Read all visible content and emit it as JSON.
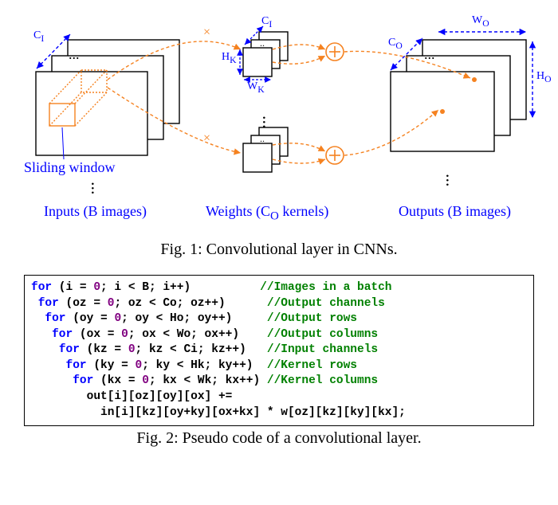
{
  "fig1": {
    "slidingWindow": "Sliding window",
    "inputs": "Inputs (B images)",
    "weights": "Weights (C",
    "weightsSubO": "O",
    "weightsRest": " kernels)",
    "outputs": "Outputs (B images)",
    "CI": "C",
    "CIsub": "I",
    "CIk": "C",
    "CIksub": "I",
    "HK": "H",
    "HKsub": "K",
    "WK": "W",
    "WKsub": "K",
    "WO": "W",
    "WOsub": "O",
    "CO": "C",
    "COsub": "O",
    "HO": "H",
    "HOsub": "O",
    "caption": "Fig. 1: Convolutional layer in CNNs."
  },
  "fig2": {
    "caption": "Fig. 2: Pseudo code of a convolutional layer.",
    "lines": {
      "l1a": "for",
      "l1b": " (i = ",
      "l1c": "0",
      "l1d": "; i < B; i++)          ",
      "l1e": "//Images in a batch",
      "l2a": "for",
      "l2b": " (oz = ",
      "l2c": "0",
      "l2d": "; oz < Co; oz++)      ",
      "l2e": "//Output channels",
      "l3a": "for",
      "l3b": " (oy = ",
      "l3c": "0",
      "l3d": "; oy < Ho; oy++)     ",
      "l3e": "//Output rows",
      "l4a": "for",
      "l4b": " (ox = ",
      "l4c": "0",
      "l4d": "; ox < Wo; ox++)    ",
      "l4e": "//Output columns",
      "l5a": "for",
      "l5b": " (kz = ",
      "l5c": "0",
      "l5d": "; kz < Ci; kz++)   ",
      "l5e": "//Input channels",
      "l6a": "for",
      "l6b": " (ky = ",
      "l6c": "0",
      "l6d": "; ky < Hk; ky++)  ",
      "l6e": "//Kernel rows",
      "l7a": "for",
      "l7b": " (kx = ",
      "l7c": "0",
      "l7d": "; kx < Wk; kx++) ",
      "l7e": "//Kernel columns",
      "l8": "        out[i][oz][oy][ox] +=",
      "l9": "          in[i][kz][oy+ky][ox+kx] * w[oz][kz][ky][kx];"
    }
  }
}
